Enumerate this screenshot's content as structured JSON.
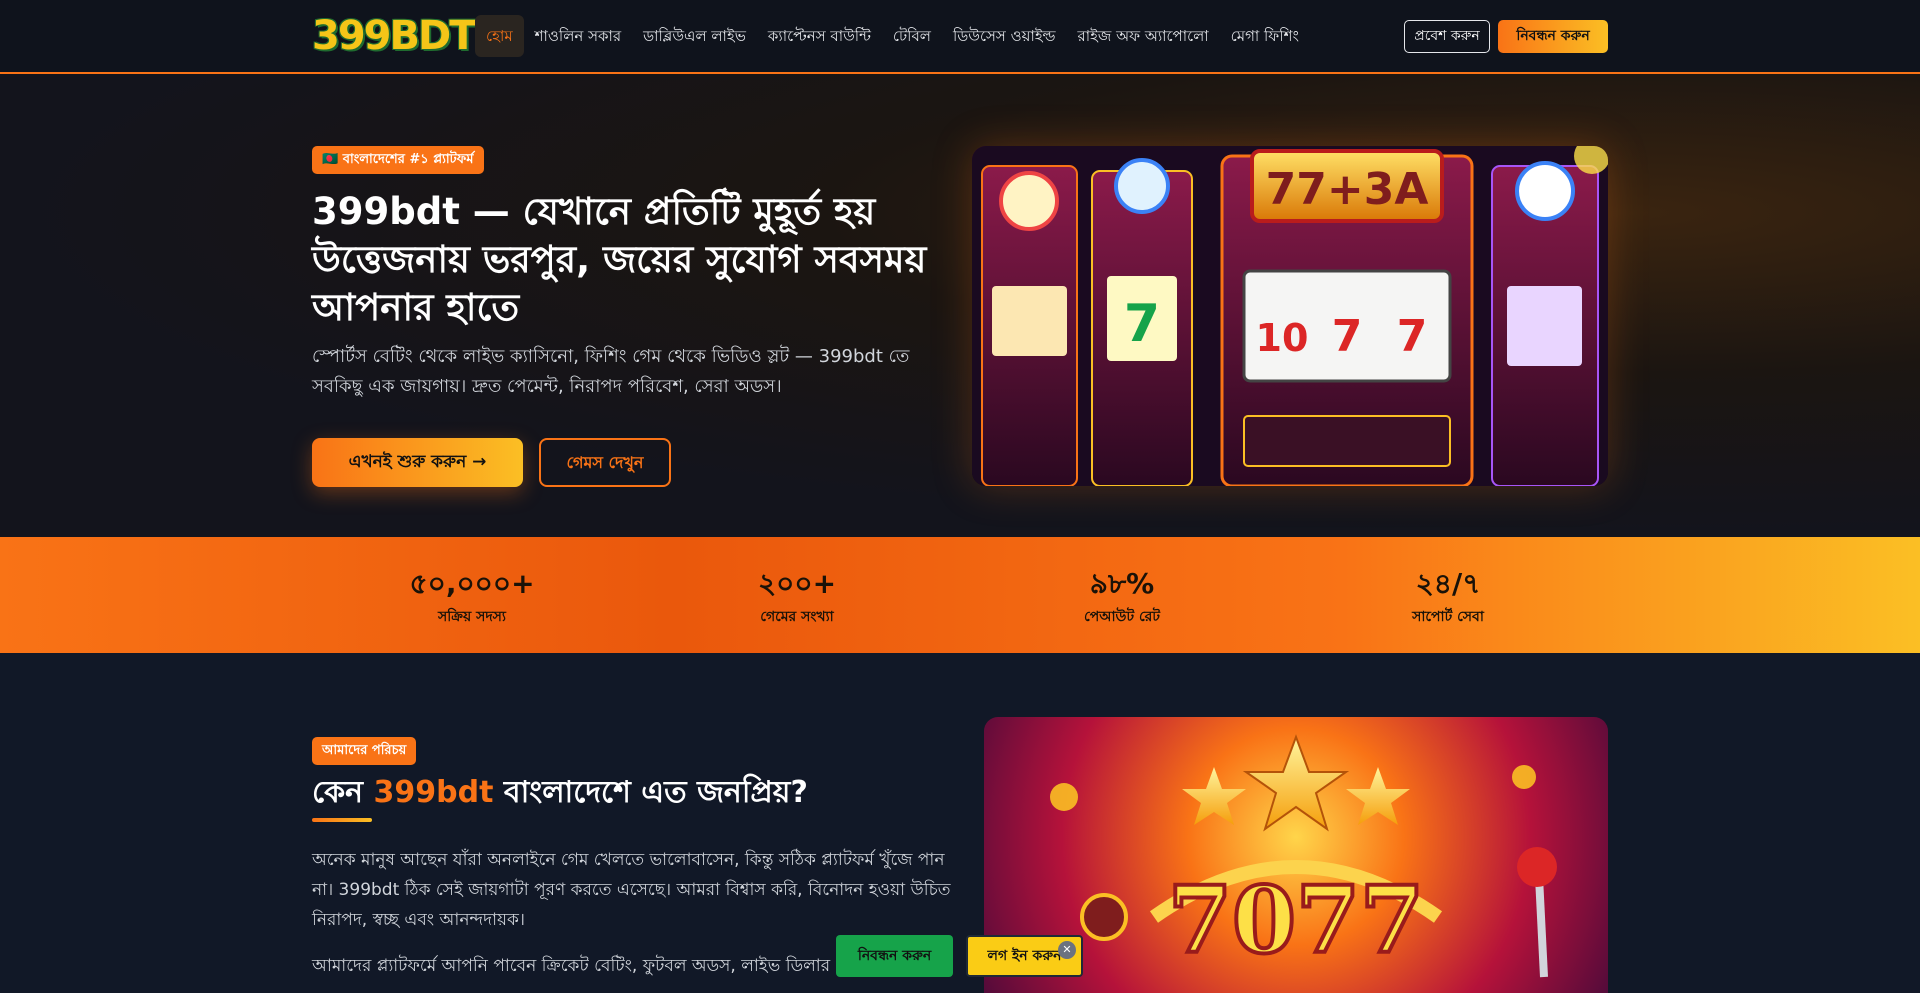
{
  "header": {
    "logo": "399BDT",
    "nav": [
      "হোম",
      "শাওলিন সকার",
      "ডাব্লিউএল লাইভ",
      "ক্যাপ্টেনস বাউন্টি",
      "টেবিল",
      "ডিউসেস ওয়াইল্ড",
      "রাইজ অফ অ্যাপোলো",
      "মেগা ফিশিং"
    ],
    "login_label": "প্রবেশ করুন",
    "register_label": "নিবন্ধন করুন"
  },
  "hero": {
    "badge": "🇧🇩 বাংলাদেশের #১ প্ল্যাটফর্ম",
    "title": "399bdt — যেখানে প্রতিটি মুহূর্ত হয় উত্তেজনায় ভরপুর, জয়ের সুযোগ সবসময় আপনার হাতে",
    "description": "স্পোর্টস বেটিং থেকে লাইভ ক্যাসিনো, ফিশিং গেম থেকে ভিডিও স্লট — 399bdt তে সবকিছু এক জায়গায়। দ্রুত পেমেন্ট, নিরাপদ পরিবেশ, সেরা অডস।",
    "start_label": "এখনই শুরু করুন →",
    "games_label": "গেমস দেখুন",
    "slot_sign": "77+3A",
    "reels_left": "7",
    "reels_main": [
      "10",
      "7",
      "7"
    ]
  },
  "stats": [
    {
      "value": "৫০,০০০+",
      "label": "সক্রিয় সদস্য"
    },
    {
      "value": "২০০+",
      "label": "গেমের সংখ্যা"
    },
    {
      "value": "৯৮%",
      "label": "পেআউট রেট"
    },
    {
      "value": "২৪/৭",
      "label": "সাপোর্ট সেবা"
    }
  ],
  "about": {
    "badge": "আমাদের পরিচয়",
    "title_prefix": "কেন ",
    "title_brand": "399bdt",
    "title_suffix": " বাংলাদেশে এত জনপ্রিয়?",
    "p1": "অনেক মানুষ আছেন যাঁরা অনলাইনে গেম খেলতে ভালোবাসেন, কিন্তু সঠিক প্ল্যাটফর্ম খুঁজে পান না। 399bdt ঠিক সেই জায়গাটা পূরণ করতে এসেছে। আমরা বিশ্বাস করি, বিনোদন হওয়া উচিত নিরাপদ, স্বচ্ছ এবং আনন্দদায়ক।",
    "p2": "আমাদের প্ল্যাটফর্মে আপনি পাবেন ক্রিকেট বেটিং, ফুটবল অডস, লাইভ ডিলার",
    "image_text": "7077"
  },
  "floating": {
    "register_label": "নিবন্ধন করুন",
    "login_label": "লগ ইন করুন",
    "close_glyph": "✕"
  }
}
